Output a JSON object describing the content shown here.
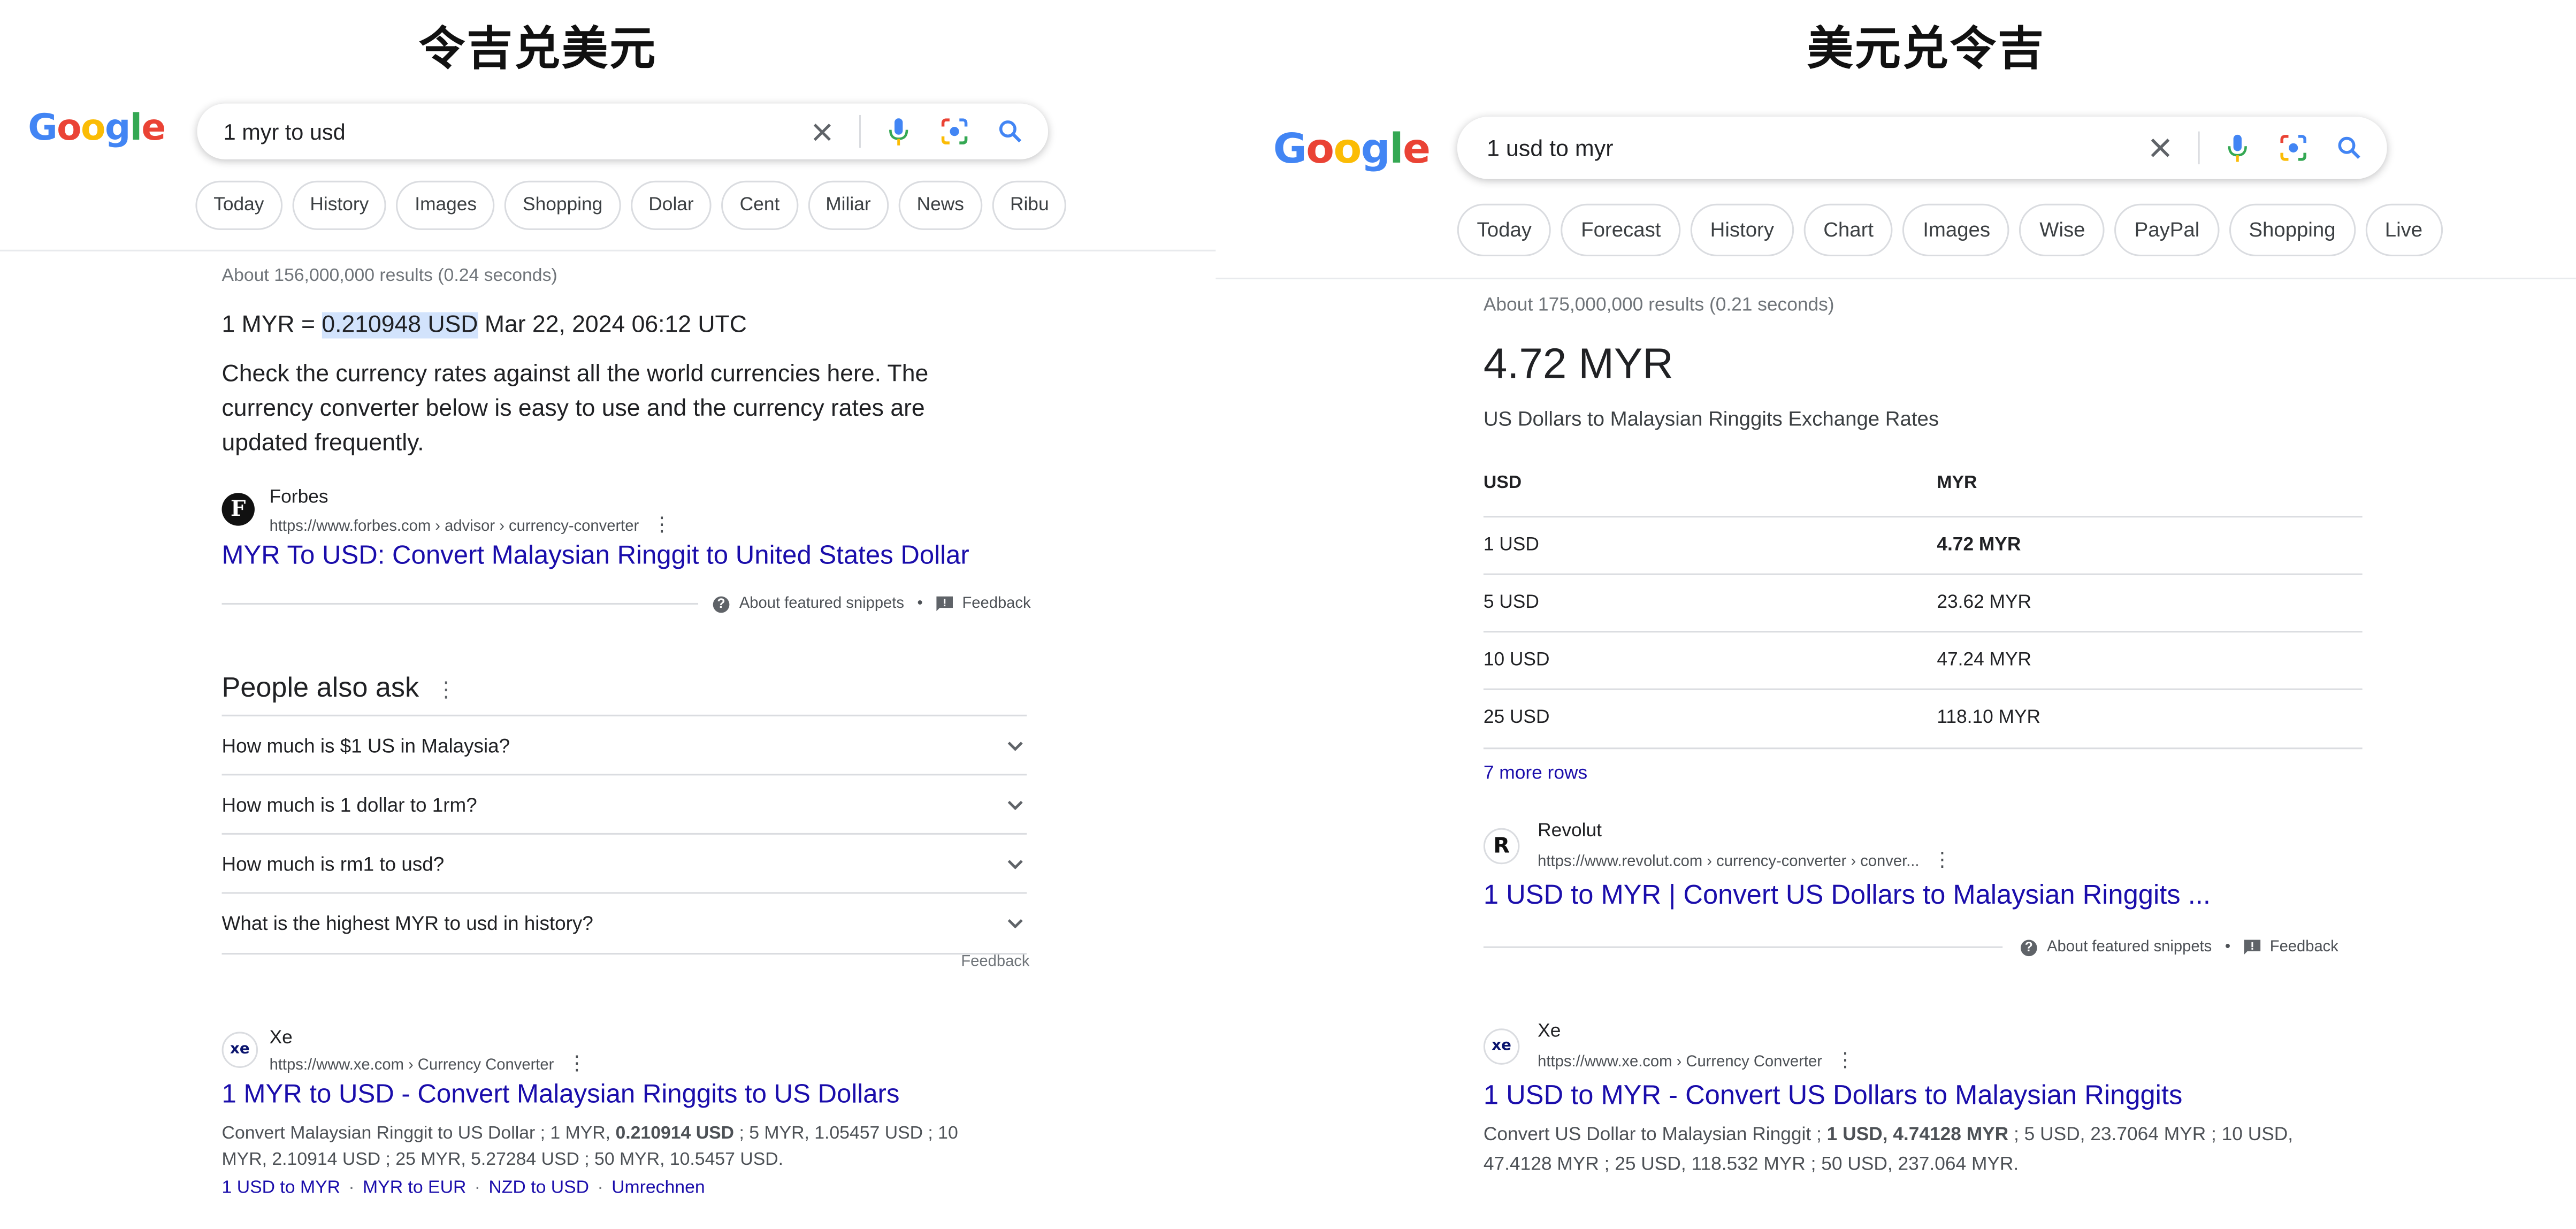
{
  "left": {
    "banner": "令吉兑美元",
    "logo": "Google",
    "search": {
      "query": "1 myr to usd"
    },
    "chips": [
      "Today",
      "History",
      "Images",
      "Shopping",
      "Dolar",
      "Cent",
      "Miliar",
      "News",
      "Ribu"
    ],
    "stats": "About 156,000,000 results (0.24 seconds)",
    "answer": {
      "prefix": "1 MYR = ",
      "value": "0.210948 USD",
      "date": " Mar 22, 2024 06:12 UTC"
    },
    "snippet_text": "Check the currency rates against all the world currencies here. The currency converter below is easy to use and the currency rates are updated frequently.",
    "featured": {
      "site": "Forbes",
      "url": "https://www.forbes.com › advisor › currency-converter",
      "title": "MYR To USD: Convert Malaysian Ringgit to United States Dollar"
    },
    "footer": {
      "about": "About featured snippets",
      "bullet": "•",
      "feedback": "Feedback"
    },
    "paa": {
      "heading": "People also ask",
      "questions": [
        "How much is $1 US in Malaysia?",
        "How much is 1 dollar to 1rm?",
        "How much is rm1 to usd?",
        "What is the highest MYR to usd in history?"
      ],
      "feedback": "Feedback"
    },
    "xe": {
      "site": "Xe",
      "url": "https://www.xe.com › Currency Converter",
      "title": "1 MYR to USD - Convert Malaysian Ringgits to US Dollars",
      "desc_a": "Convert Malaysian Ringgit to US Dollar ; 1 MYR, ",
      "desc_bold": "0.210914 USD",
      "desc_b": " ; 5 MYR, 1.05457 USD ; 10",
      "desc_line2": "MYR, 2.10914 USD ; 25 MYR, 5.27284 USD ; 50 MYR, 10.5457 USD.",
      "related": [
        "1 USD to MYR",
        "MYR to EUR",
        "NZD to USD",
        "Umrechnen"
      ],
      "related_sep": "·"
    }
  },
  "right": {
    "banner": "美元兑令吉",
    "logo": "Google",
    "search": {
      "query": "1 usd to myr"
    },
    "chips": [
      "Today",
      "Forecast",
      "History",
      "Chart",
      "Images",
      "Wise",
      "PayPal",
      "Shopping",
      "Live"
    ],
    "stats": "About 175,000,000 results (0.21 seconds)",
    "big_answer": "4.72 MYR",
    "subtitle": "US Dollars to Malaysian Ringgits Exchange Rates",
    "table": {
      "headers": [
        "USD",
        "MYR"
      ],
      "rows": [
        [
          "1 USD",
          "4.72 MYR"
        ],
        [
          "5 USD",
          "23.62 MYR"
        ],
        [
          "10 USD",
          "47.24 MYR"
        ],
        [
          "25 USD",
          "118.10 MYR"
        ]
      ],
      "more": "7 more rows"
    },
    "featured": {
      "site": "Revolut",
      "url": "https://www.revolut.com › currency-converter › conver...",
      "title": "1 USD to MYR | Convert US Dollars to Malaysian Ringgits ..."
    },
    "footer": {
      "about": "About featured snippets",
      "bullet": "•",
      "feedback": "Feedback"
    },
    "xe": {
      "site": "Xe",
      "url": "https://www.xe.com › Currency Converter",
      "title": "1 USD to MYR - Convert US Dollars to Malaysian Ringgits",
      "desc_a": "Convert US Dollar to Malaysian Ringgit ; ",
      "desc_bold": "1 USD, 4.74128 MYR",
      "desc_b": " ; 5 USD, 23.7064 MYR ; 10 USD,",
      "desc_line2": "47.4128 MYR ; 25 USD, 118.532 MYR ; 50 USD, 237.064 MYR."
    }
  }
}
